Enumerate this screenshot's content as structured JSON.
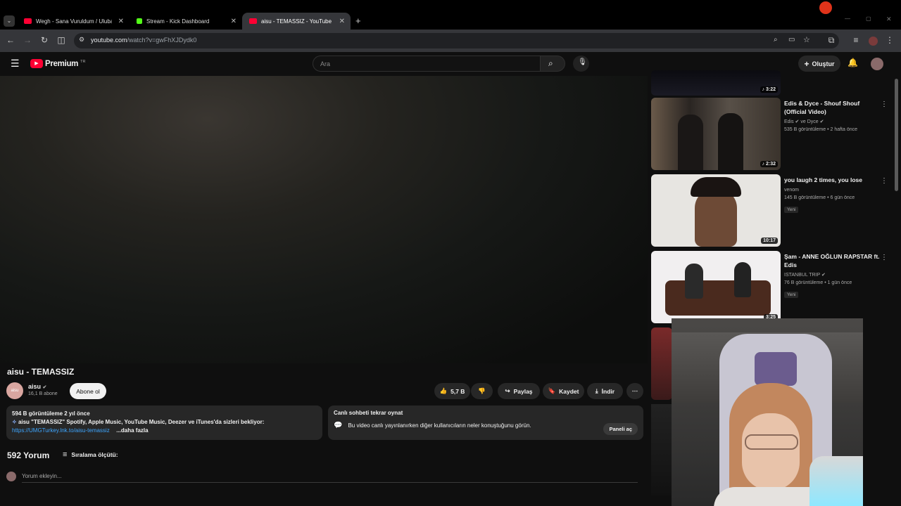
{
  "browser": {
    "tabs": [
      {
        "title": "Wegh - Sana Vuruldum / Ulubat",
        "color": "#ff0033"
      },
      {
        "title": "Stream - Kick Dashboard",
        "color": "#53fc18"
      },
      {
        "title": "aisu - TEMASSIZ - YouTube",
        "color": "#ff0033"
      }
    ],
    "url_host": "youtube.com",
    "url_path": "/watch?v=gwFhXJDydk0"
  },
  "header": {
    "brand": "Premium",
    "region": "TR",
    "search_placeholder": "Ara",
    "create_label": "Oluştur"
  },
  "video": {
    "title": "aisu - TEMASSIZ",
    "channel": "aisu",
    "channel_avatar_text": "aisu",
    "subscribers": "16,1 B abone",
    "subscribe_label": "Abone ol",
    "likes": "5,7 B",
    "share_label": "Paylaş",
    "save_label": "Kaydet",
    "download_label": "İndir"
  },
  "description": {
    "stats": "594 B görüntüleme  2 yıl önce",
    "line1": "aisu \"TEMASSIZ\" Spotify, Apple Music, YouTube Music, Deezer ve iTunes'da sizleri bekliyor:",
    "link": "https://UMGTurkey.lnk.to/aisu-temassiz",
    "more": "...daha fazla"
  },
  "chat_replay": {
    "title": "Canlı sohbeti tekrar oynat",
    "text": "Bu video canlı yayınlanırken diğer kullanıcıların neler konuştuğunu görün.",
    "button": "Paneli aç"
  },
  "comments": {
    "count": "592 Yorum",
    "sort_label": "Sıralama ölçütü:",
    "placeholder": "Yorum ekleyin..."
  },
  "sidebar": [
    {
      "title": "",
      "channel": "",
      "meta": "",
      "duration": "3:22"
    },
    {
      "title": "Edis & Dyce - Shouf Shouf (Official Video)",
      "channel": "Edis ✔ ve Dyce ✔",
      "meta": "535 B görüntüleme • 2 hafta önce",
      "duration": "2:32"
    },
    {
      "title": "you laugh 2 times, you lose",
      "channel": "venom",
      "meta": "145 B görüntüleme • 6 gün önce",
      "badge": "Yeni",
      "duration": "10:17"
    },
    {
      "title": "Şam - ANNE OĞLUN RAPSTAR ft. Edis",
      "channel": "ISTANBUL TRIP ✔",
      "meta": "76 B görüntüleme • 1 gün önce",
      "badge": "Yeni",
      "duration": "3:25"
    }
  ]
}
